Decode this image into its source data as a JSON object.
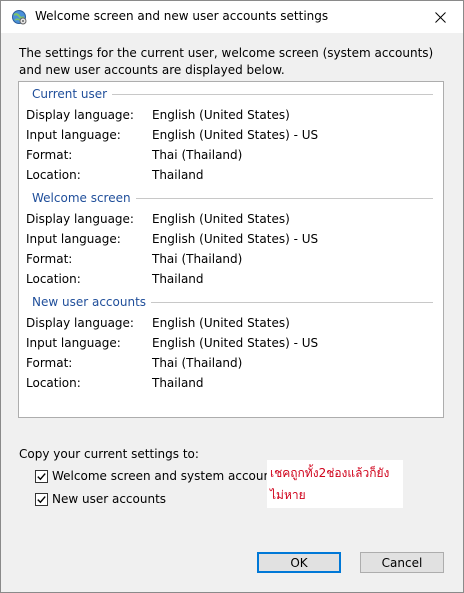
{
  "window": {
    "title": "Welcome screen and new user accounts settings",
    "icon": "globe-settings-icon"
  },
  "intro_text": "The settings for the current user, welcome screen (system accounts) and new user accounts are displayed below.",
  "sections": [
    {
      "title": "Current user",
      "rows": [
        {
          "label": "Display language:",
          "value": "English (United States)"
        },
        {
          "label": "Input language:",
          "value": "English (United States) - US"
        },
        {
          "label": "Format:",
          "value": "Thai (Thailand)"
        },
        {
          "label": "Location:",
          "value": "Thailand"
        }
      ]
    },
    {
      "title": "Welcome screen",
      "rows": [
        {
          "label": "Display language:",
          "value": "English (United States)"
        },
        {
          "label": "Input language:",
          "value": "English (United States) - US"
        },
        {
          "label": "Format:",
          "value": "Thai (Thailand)"
        },
        {
          "label": "Location:",
          "value": "Thailand"
        }
      ]
    },
    {
      "title": "New user accounts",
      "rows": [
        {
          "label": "Display language:",
          "value": "English (United States)"
        },
        {
          "label": "Input language:",
          "value": "English (United States) - US"
        },
        {
          "label": "Format:",
          "value": "Thai (Thailand)"
        },
        {
          "label": "Location:",
          "value": "Thailand"
        }
      ]
    }
  ],
  "copy": {
    "label": "Copy your current settings to:",
    "options": [
      {
        "label": "Welcome screen and system accounts",
        "checked": true
      },
      {
        "label": "New user accounts",
        "checked": true
      }
    ]
  },
  "annotation": {
    "text": "เชคถูกทั้ง2ช่องแล้วก็ยังไม่หาย",
    "color": "#d0021b"
  },
  "buttons": {
    "ok": "OK",
    "cancel": "Cancel"
  },
  "colors": {
    "section_title": "#1f4e9a",
    "accent": "#0078d7"
  }
}
